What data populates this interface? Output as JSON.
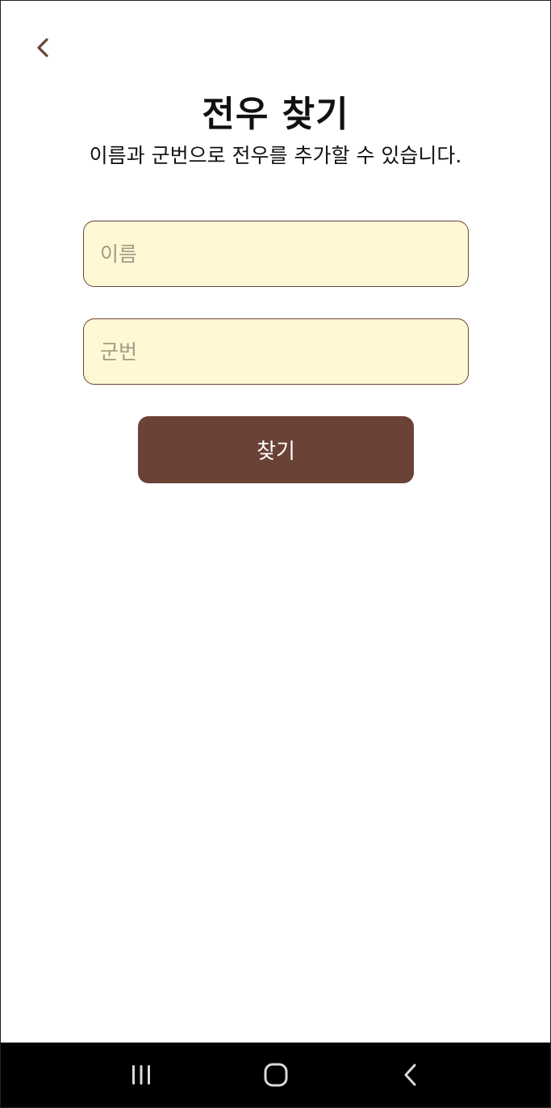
{
  "header": {
    "back_icon": "chevron-left-icon",
    "title": "전우 찾기",
    "subtitle": "이름과 군번으로 전우를 추가할 수 있습니다."
  },
  "form": {
    "name_placeholder": "이름",
    "name_value": "",
    "service_number_placeholder": "군번",
    "service_number_value": "",
    "submit_label": "찾기"
  },
  "navigation_bar": {
    "items": [
      {
        "icon": "recent-apps-icon"
      },
      {
        "icon": "home-icon"
      },
      {
        "icon": "back-icon"
      }
    ]
  },
  "colors": {
    "accent": "#6b4236",
    "field_background": "#fff8d4",
    "nav_background": "#000000"
  }
}
